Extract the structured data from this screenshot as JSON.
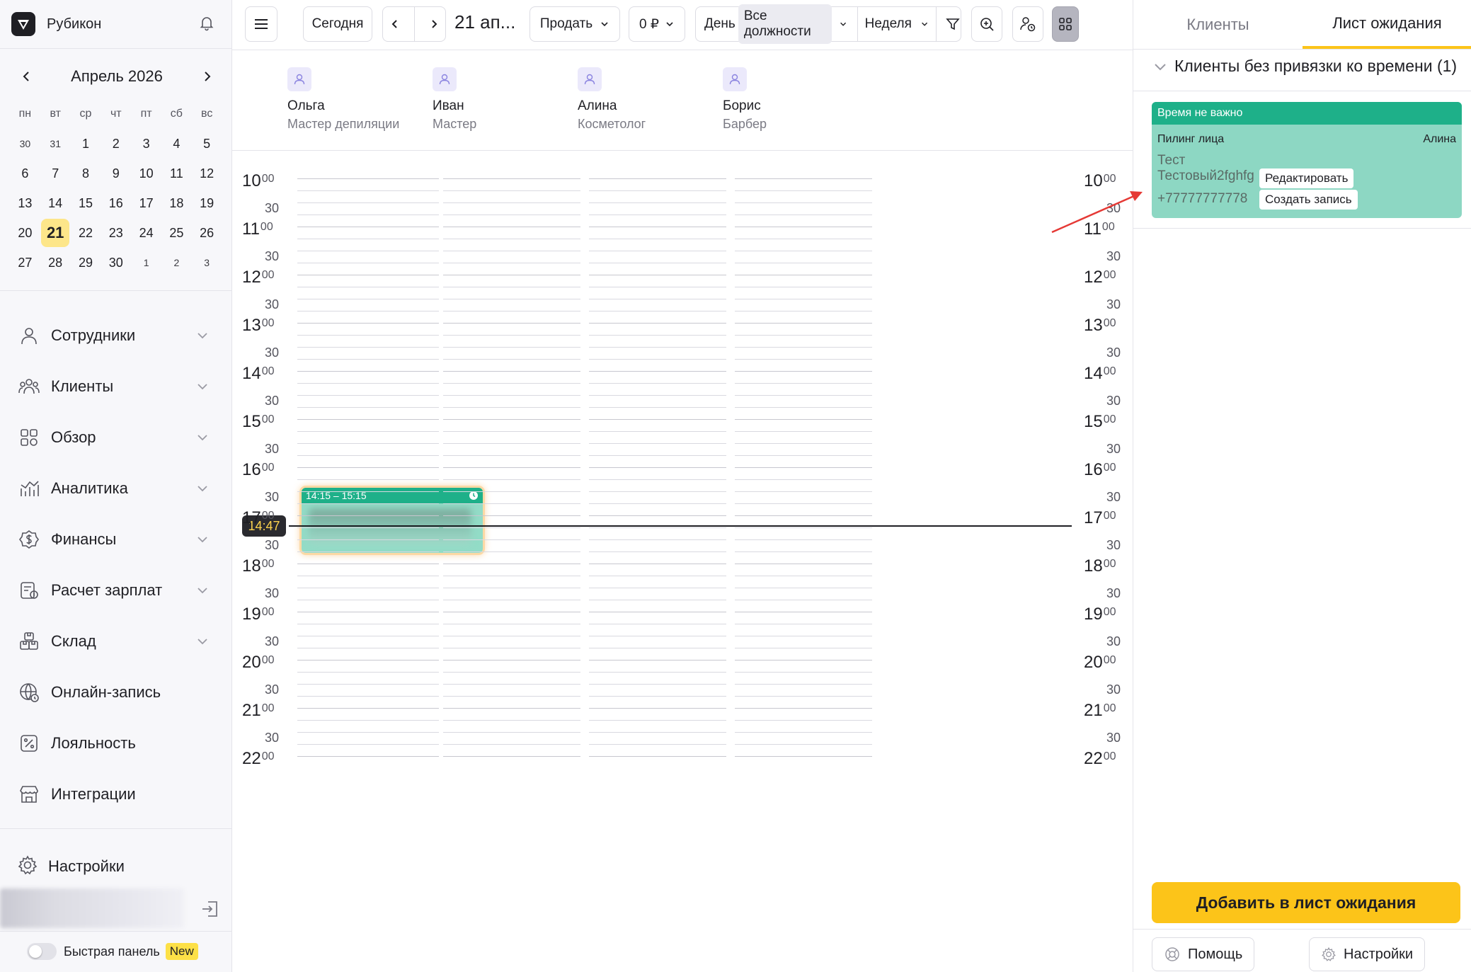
{
  "brand": {
    "name": "Рубикон"
  },
  "calendar": {
    "month_label": "Апрель 2026",
    "weekdays": [
      "пн",
      "вт",
      "ср",
      "чт",
      "пт",
      "сб",
      "вс"
    ],
    "weeks": [
      [
        "30",
        "31",
        "1",
        "2",
        "3",
        "4",
        "5"
      ],
      [
        "6",
        "7",
        "8",
        "9",
        "10",
        "11",
        "12"
      ],
      [
        "13",
        "14",
        "15",
        "16",
        "17",
        "18",
        "19"
      ],
      [
        "20",
        "21",
        "22",
        "23",
        "24",
        "25",
        "26"
      ],
      [
        "27",
        "28",
        "29",
        "30",
        "1",
        "2",
        "3"
      ]
    ],
    "selected_day": "21"
  },
  "menu": [
    {
      "label": "Сотрудники",
      "icon": "user-icon",
      "has_chevron": true
    },
    {
      "label": "Клиенты",
      "icon": "users-icon",
      "has_chevron": true
    },
    {
      "label": "Обзор",
      "icon": "grid-icon",
      "has_chevron": true
    },
    {
      "label": "Аналитика",
      "icon": "analytics-icon",
      "has_chevron": true
    },
    {
      "label": "Финансы",
      "icon": "finance-icon",
      "has_chevron": true
    },
    {
      "label": "Расчет зарплат",
      "icon": "payroll-icon",
      "has_chevron": true
    },
    {
      "label": "Склад",
      "icon": "warehouse-icon",
      "has_chevron": true
    },
    {
      "label": "Онлайн-запись",
      "icon": "globe-icon",
      "has_chevron": false
    },
    {
      "label": "Лояльность",
      "icon": "percent-icon",
      "has_chevron": false
    },
    {
      "label": "Интеграции",
      "icon": "store-icon",
      "has_chevron": false
    }
  ],
  "sidebar_footer": {
    "settings_label": "Настройки",
    "quick_panel_label": "Быстрая панель",
    "new_badge": "New"
  },
  "toolbar": {
    "today": "Сегодня",
    "date": "21 ап...",
    "sell": "Продать",
    "money": "0 ₽",
    "day": "День",
    "positions": "Все должности",
    "week": "Неделя"
  },
  "staff": [
    {
      "name": "Ольга",
      "role": "Мастер депиляции"
    },
    {
      "name": "Иван",
      "role": "Мастер"
    },
    {
      "name": "Алина",
      "role": "Косметолог"
    },
    {
      "name": "Борис",
      "role": "Барбер"
    }
  ],
  "hours": [
    "10",
    "11",
    "12",
    "13",
    "14",
    "15",
    "16",
    "17",
    "18",
    "19",
    "20",
    "21",
    "22"
  ],
  "hour_suffix": "00",
  "half_label": "30",
  "appointment": {
    "time": "14:15 – 15:15"
  },
  "now": {
    "time": "14:47"
  },
  "right_panel": {
    "tabs": [
      "Клиенты",
      "Лист ожидания"
    ],
    "active_tab": 1,
    "group_label": "Клиенты без привязки ко времени (1)",
    "card": {
      "header": "Время не важно",
      "service": "Пилинг лица",
      "employee": "Алина",
      "name1": "Тест",
      "name2": "Тестовый2fghfg",
      "phone": "+77777777778",
      "edit": "Редактировать",
      "create": "Создать запись"
    },
    "add_button": "Добавить в лист ожидания",
    "help": "Помощь",
    "settings": "Настройки"
  },
  "colors": {
    "accent_yellow": "#fcc419",
    "green_header": "#1eb089",
    "green_body": "#8dd7c3",
    "annotation_red": "#e53935"
  }
}
